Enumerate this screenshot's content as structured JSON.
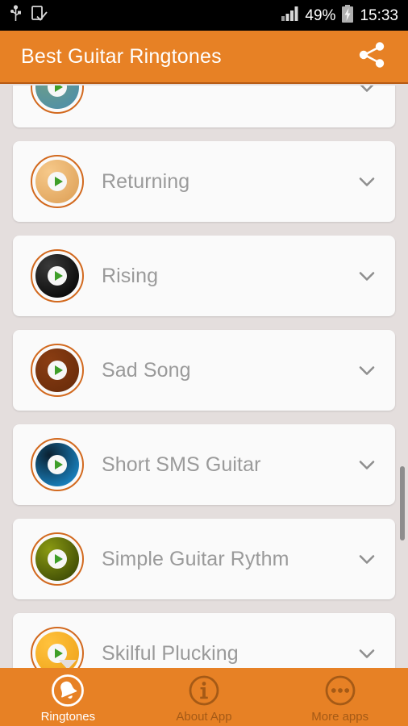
{
  "status_bar": {
    "icons_left": [
      "usb-icon",
      "device-check-icon"
    ],
    "signal_icon": "signal-bars-icon",
    "battery_percent": "49%",
    "battery_icon": "battery-charging-icon",
    "time": "15:33",
    "background_color": "#000000",
    "text_color": "#ffffff"
  },
  "app_bar": {
    "title": "Best Guitar Ringtones",
    "share_icon": "share-icon",
    "background_color": "#e78125",
    "title_color": "#ffffff"
  },
  "list": {
    "accent_ring_color": "#d2691e",
    "title_color": "#9a9a9a",
    "card_color": "#fafafa",
    "expand_icon": "chevron-down-icon",
    "play_icon": "play-icon",
    "items": [
      {
        "title": "",
        "thumb_name": "ringtone-thumbnail-partial-top",
        "thumb_color_a": "#6f9f86",
        "thumb_color_b": "#4f8fa8",
        "partial": "top"
      },
      {
        "title": "Returning",
        "thumb_name": "ringtone-thumbnail-returning",
        "thumb_color_a": "#f6c98a",
        "thumb_color_b": "#e0a45c",
        "partial": "none"
      },
      {
        "title": "Rising",
        "thumb_name": "ringtone-thumbnail-rising",
        "thumb_color_a": "#3a3a3a",
        "thumb_color_b": "#070707",
        "partial": "none"
      },
      {
        "title": "Sad Song",
        "thumb_name": "ringtone-thumbnail-sad-song",
        "thumb_color_a": "#8a3d12",
        "thumb_color_b": "#6b2d0b",
        "partial": "none"
      },
      {
        "title": "Short SMS Guitar",
        "thumb_name": "ringtone-thumbnail-short-sms-guitar",
        "thumb_color_a": "#0b2030",
        "thumb_color_b": "#1a88c8",
        "partial": "none"
      },
      {
        "title": "Simple Guitar Rythm",
        "thumb_name": "ringtone-thumbnail-simple-guitar-rythm",
        "thumb_color_a": "#8a9a12",
        "thumb_color_b": "#3d4a05",
        "partial": "none"
      },
      {
        "title": "Skilful Plucking",
        "thumb_name": "ringtone-thumbnail-skilful-plucking",
        "thumb_color_a": "#ffc23d",
        "thumb_color_b": "#f0a51c",
        "partial": "bottom"
      }
    ]
  },
  "scrollbar": {
    "thumb_color": "#8d8d8d"
  },
  "bottom_nav": {
    "background_color": "#e78125",
    "active_color": "#ffffff",
    "inactive_color": "#a55a16",
    "items": [
      {
        "label": "Ringtones",
        "icon": "bell-circle-icon",
        "active": true
      },
      {
        "label": "About App",
        "icon": "info-circle-icon",
        "active": false
      },
      {
        "label": "More apps",
        "icon": "ellipsis-circle-icon",
        "active": false
      }
    ]
  }
}
